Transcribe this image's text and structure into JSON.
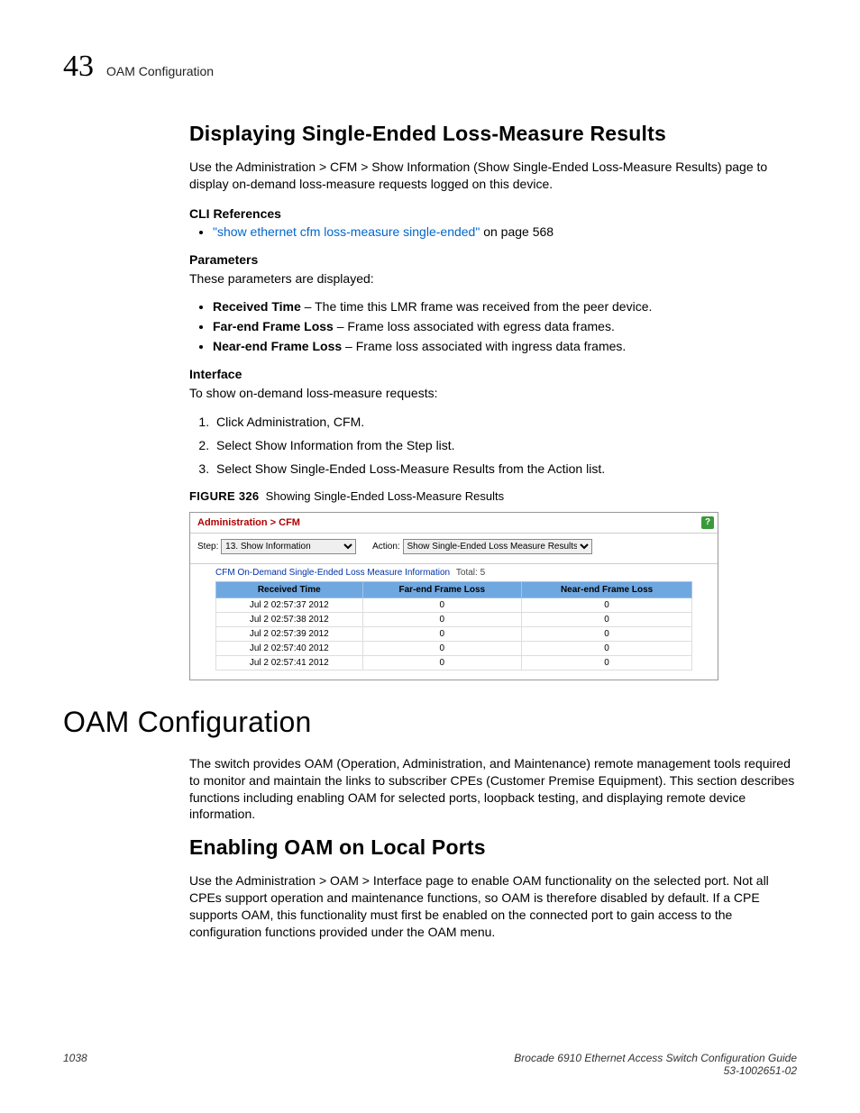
{
  "header": {
    "chapter_number": "43",
    "chapter_title": "OAM Configuration"
  },
  "section1": {
    "heading": "Displaying Single-Ended Loss-Measure Results",
    "intro": "Use the Administration > CFM > Show Information (Show Single-Ended Loss-Measure Results) page to display on-demand loss-measure requests logged on this device.",
    "cli_refs_label": "CLI References",
    "cli_link_text": "\"show ethernet cfm loss-measure single-ended\"",
    "cli_link_suffix": " on page 568",
    "params_label": "Parameters",
    "params_intro": "These parameters are displayed:",
    "params": [
      {
        "term": "Received Time",
        "desc": " – The time this LMR frame was received from the peer device."
      },
      {
        "term": "Far-end Frame Loss",
        "desc": " – Frame loss associated with egress data frames."
      },
      {
        "term": "Near-end Frame Loss",
        "desc": " – Frame loss associated with ingress data frames."
      }
    ],
    "interface_label": "Interface",
    "interface_intro": "To show on-demand loss-measure requests:",
    "steps": [
      "Click Administration, CFM.",
      "Select Show Information from the Step list.",
      "Select Show Single-Ended Loss-Measure Results from the Action list."
    ],
    "figure_label": "FIGURE 326",
    "figure_caption": "Showing Single-Ended Loss-Measure Results"
  },
  "ui_screenshot": {
    "breadcrumb": "Administration > CFM",
    "step_label": "Step:",
    "step_value": "13. Show Information",
    "action_label": "Action:",
    "action_value": "Show Single-Ended Loss Measure Results",
    "table_title": "CFM On-Demand Single-Ended Loss Measure Information",
    "total_label": "Total: 5",
    "columns": [
      "Received Time",
      "Far-end Frame Loss",
      "Near-end Frame Loss"
    ],
    "rows": [
      {
        "time": "Jul 2 02:57:37 2012",
        "far": "0",
        "near": "0"
      },
      {
        "time": "Jul 2 02:57:38 2012",
        "far": "0",
        "near": "0"
      },
      {
        "time": "Jul 2 02:57:39 2012",
        "far": "0",
        "near": "0"
      },
      {
        "time": "Jul 2 02:57:40 2012",
        "far": "0",
        "near": "0"
      },
      {
        "time": "Jul 2 02:57:41 2012",
        "far": "0",
        "near": "0"
      }
    ]
  },
  "section2": {
    "heading": "OAM Configuration",
    "intro": "The switch provides OAM (Operation, Administration, and Maintenance) remote management tools required to monitor and maintain the links to subscriber CPEs (Customer Premise Equipment). This section describes functions including enabling OAM for selected ports, loopback testing, and displaying remote device information.",
    "sub_heading": "Enabling OAM on Local Ports",
    "sub_intro": "Use the Administration > OAM > Interface page to enable OAM functionality on the selected port. Not all CPEs support operation and maintenance functions, so OAM is therefore disabled by default. If a CPE supports OAM, this functionality must first be enabled on the connected port to gain access to the configuration functions provided under the OAM menu."
  },
  "footer": {
    "page": "1038",
    "book": "Brocade 6910 Ethernet Access Switch Configuration Guide",
    "docnum": "53-1002651-02"
  }
}
